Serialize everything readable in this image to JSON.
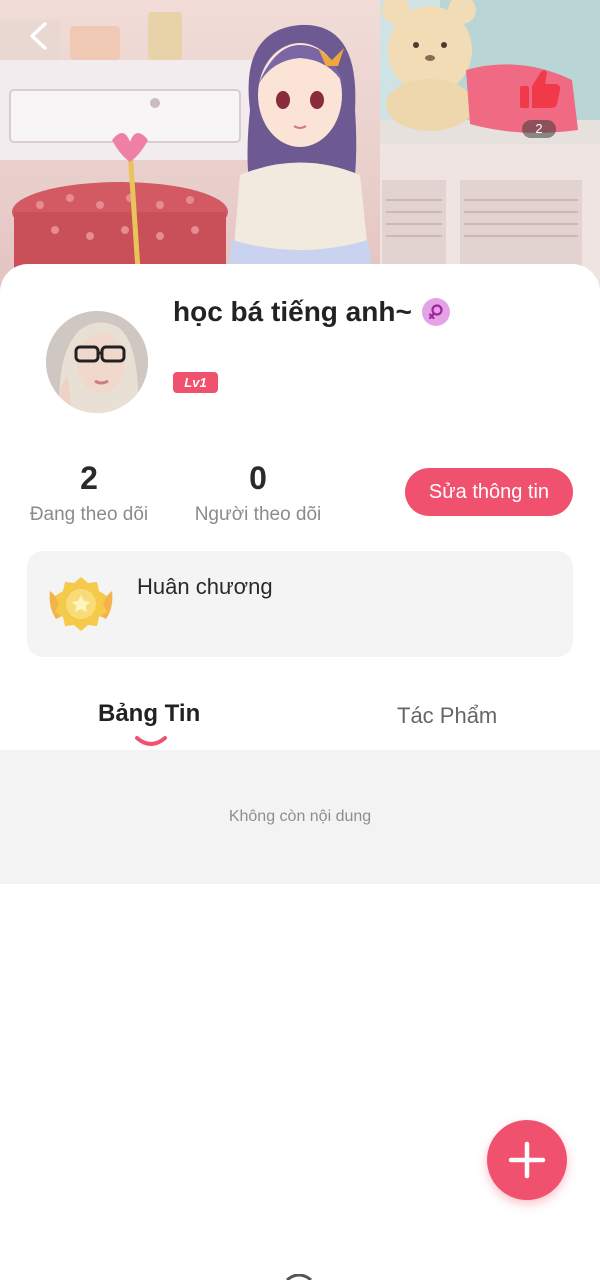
{
  "header": {
    "back_icon": "chevron-left-icon",
    "like_icon": "thumbs-up-icon",
    "like_count": "2"
  },
  "profile": {
    "username": "học bá tiếng anh~",
    "gender_icon": "female-symbol-icon",
    "level": "Lv1"
  },
  "stats": {
    "following_count": "2",
    "following_label": "Đang theo dõi",
    "followers_count": "0",
    "followers_label": "Người theo dõi"
  },
  "edit_button_label": "Sửa thông tin",
  "medals": {
    "title": "Huân chương",
    "icon": "medal-icon"
  },
  "tabs": [
    {
      "label": "Bảng Tin",
      "active": true
    },
    {
      "label": "Tác Phẩm",
      "active": false
    }
  ],
  "feed": {
    "empty_text": "Không còn nội dung"
  },
  "fab_icon": "plus-icon",
  "colors": {
    "accent": "#f0516e",
    "card_background": "#f4f4f4",
    "muted_text": "#8b8b8b"
  }
}
